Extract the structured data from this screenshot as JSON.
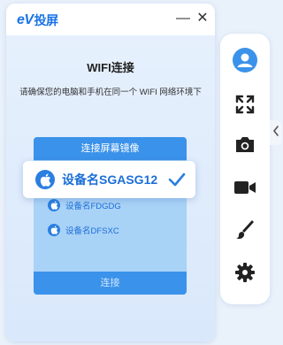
{
  "app": {
    "logo_ev": "eV",
    "logo_cn": "投屏"
  },
  "window_controls": {
    "minimize": "—",
    "close": "✕"
  },
  "main": {
    "heading": "WIFI连接",
    "subtitle": "请确保您的电脑和手机在同一个 WIFI 网络环境下",
    "panel_title": "连接屏幕镜像",
    "selected_device": "设备名SGASG12",
    "devices": [
      "设备名FDGDG",
      "设备名DFSXC"
    ],
    "connect_label": "连接"
  },
  "toolbar": {
    "icons": [
      "user-icon",
      "fullscreen-icon",
      "camera-icon",
      "video-camera-icon",
      "brush-icon",
      "gear-icon"
    ]
  },
  "colors": {
    "accent": "#3b92ea",
    "brand": "#1a73e8",
    "panel": "#a9d2f7"
  }
}
